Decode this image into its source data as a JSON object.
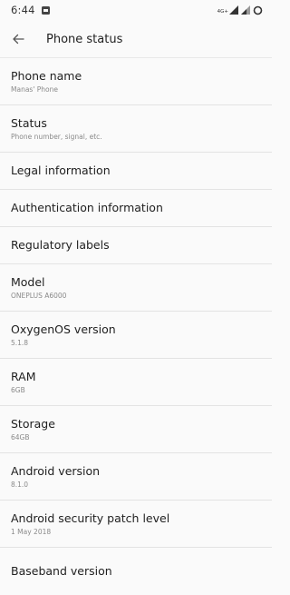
{
  "status_bar": {
    "time": "6:44",
    "network_type": "4G+"
  },
  "header": {
    "title": "Phone status"
  },
  "items": [
    {
      "title": "Phone name",
      "subtitle": "Manas' Phone"
    },
    {
      "title": "Status",
      "subtitle": "Phone number, signal, etc."
    },
    {
      "title": "Legal information"
    },
    {
      "title": "Authentication information"
    },
    {
      "title": "Regulatory labels"
    },
    {
      "title": "Model",
      "subtitle": "ONEPLUS A6000"
    },
    {
      "title": "OxygenOS version",
      "subtitle": "5.1.8"
    },
    {
      "title": "RAM",
      "subtitle": "6GB"
    },
    {
      "title": "Storage",
      "subtitle": "64GB"
    },
    {
      "title": "Android version",
      "subtitle": "8.1.0"
    },
    {
      "title": "Android security patch level",
      "subtitle": "1 May 2018"
    },
    {
      "title": "Baseband version"
    }
  ],
  "icons": {
    "back": "arrow-back-icon",
    "notification": "message-notification-icon",
    "signal": "signal-strength-icon",
    "battery": "battery-ring-icon"
  }
}
